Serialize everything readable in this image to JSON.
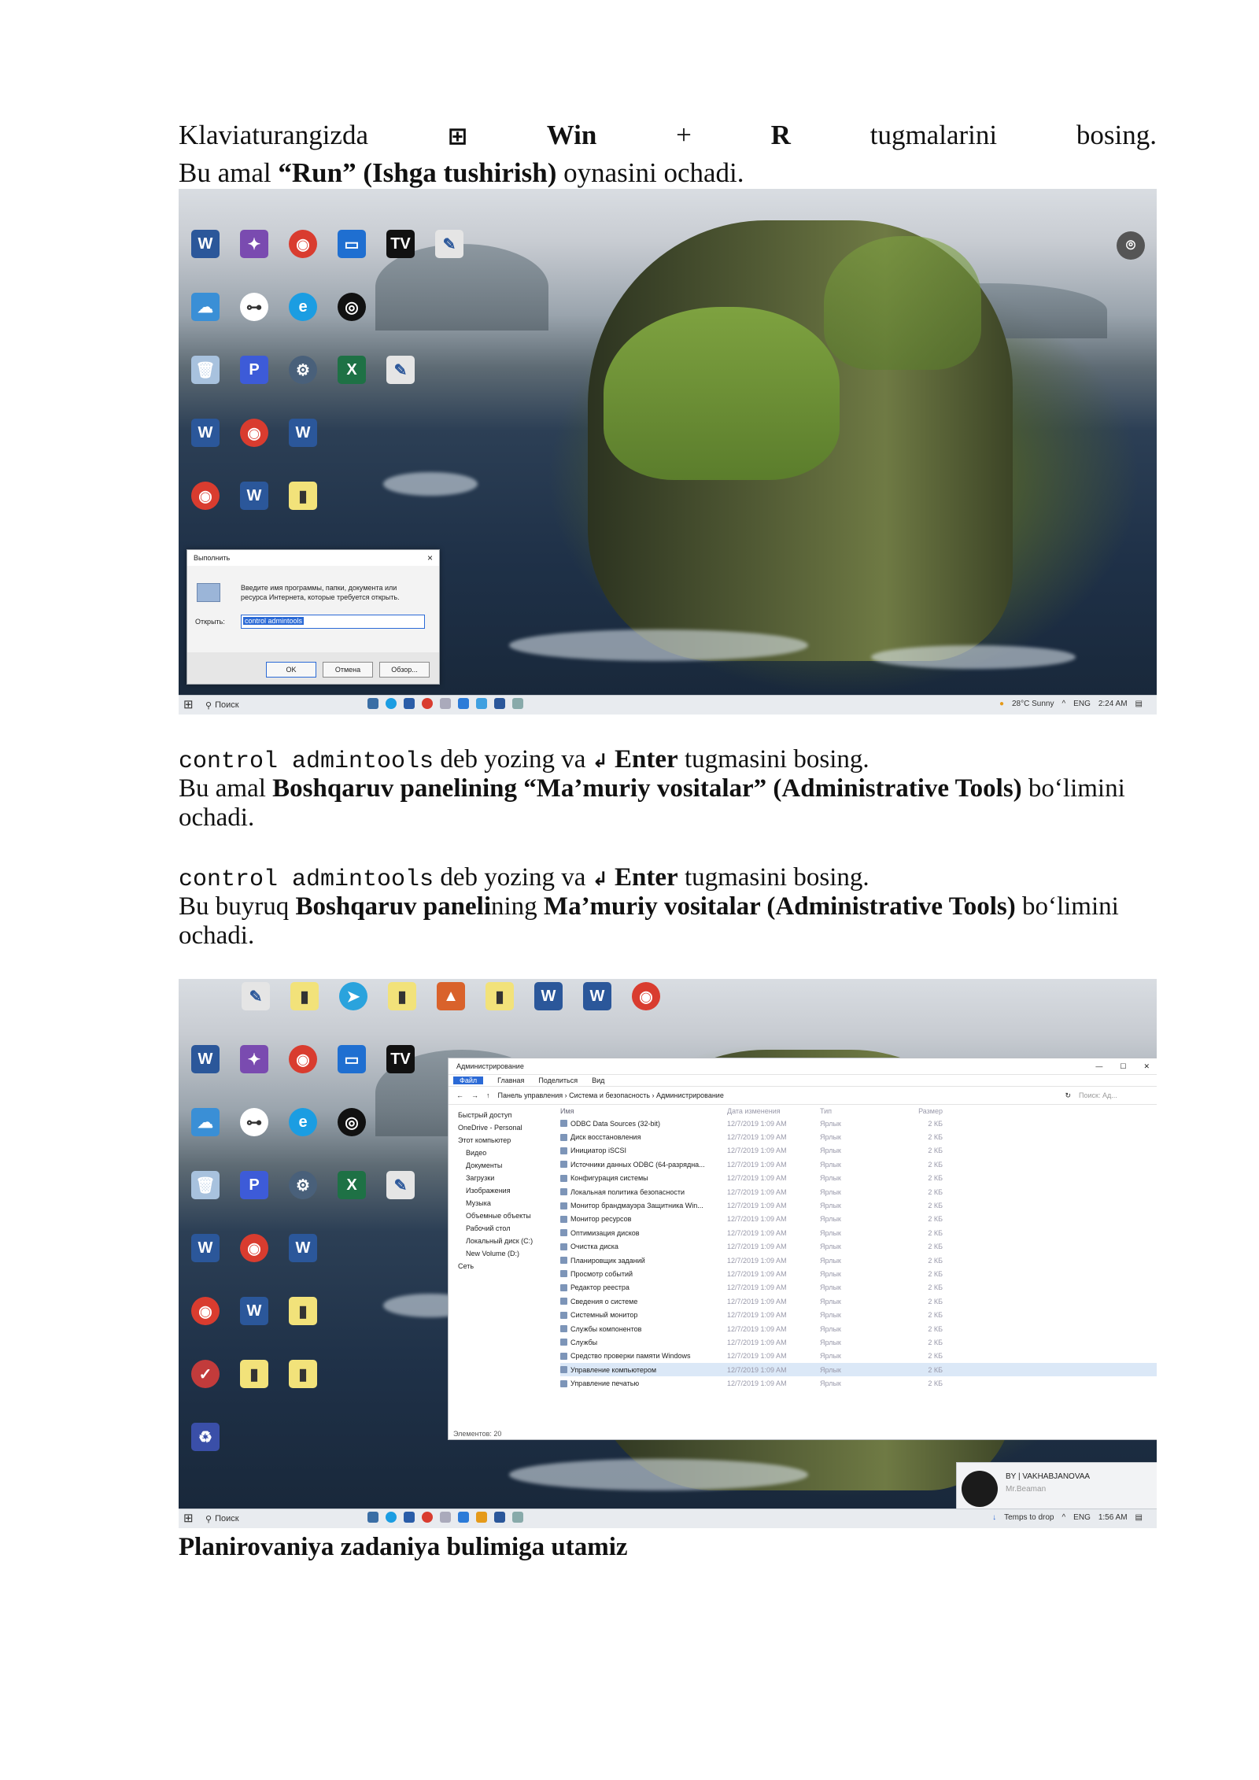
{
  "para1": {
    "line1": [
      "Klaviaturangizda",
      "⊞",
      "Win",
      "+",
      "R",
      "tugmalarini",
      "bosing."
    ],
    "line2_pre": "Bu amal ",
    "line2_bold": "“Run” (Ishga tushirish)",
    "line2_post": " oynasini ochadi."
  },
  "shot1": {
    "run_dialog": {
      "title": "Выполнить",
      "close": "×",
      "description": "Введите имя программы, папки, документа или ресурса Интернета, которые требуется открыть.",
      "open_label": "Открыть:",
      "input_value": "control admintools",
      "ok": "OK",
      "cancel": "Отмена",
      "browse": "Обзор..."
    },
    "taskbar": {
      "search": "Поиск",
      "weather": "28°C Sunny",
      "lang": "ENG",
      "time": "2:24 AM"
    }
  },
  "para2": {
    "cmd": "control admintools",
    "mid": " deb yozing va ",
    "enter_sym": "↲",
    "enter_bold": " Enter",
    "end": " tugmasini bosing.",
    "l2_pre": "Bu amal ",
    "l2_bold": "Boshqaruv panelining “Ma’muriy vositalar” (Administrative Tools)",
    "l2_post": " bo‘limini",
    "l3": "ochadi."
  },
  "para3": {
    "cmd": "control admintools",
    "mid": " deb yozing va ",
    "enter_sym": "↲",
    "enter_bold": " Enter",
    "end": " tugmasini bosing.",
    "l2_pre": "Bu buyruq ",
    "l2_bold1": "Boshqaruv paneli",
    "l2_mid": "ning ",
    "l2_bold2": "Ma’muriy vositalar (Administrative Tools)",
    "l2_post": " bo‘limini",
    "l3": "ochadi."
  },
  "shot2": {
    "explorer": {
      "title": "Администрирование",
      "ribbon": [
        "Файл",
        "Главная",
        "Поделиться",
        "Вид"
      ],
      "breadcrumb": "Панель управления › Система и безопасность › Администрирование",
      "search_placeholder": "Поиск: Ад...",
      "nav": [
        "Быстрый доступ",
        "OneDrive - Personal",
        "Этот компьютер",
        "Видео",
        "Документы",
        "Загрузки",
        "Изображения",
        "Музыка",
        "Объемные объекты",
        "Рабочий стол",
        "Локальный диск (C:)",
        "New Volume (D:)",
        "Сеть"
      ],
      "headers": [
        "Имя",
        "Дата изменения",
        "Тип",
        "Размер"
      ],
      "files": [
        "ODBC Data Sources (32-bit)",
        "Диск восстановления",
        "Инициатор iSCSI",
        "Источники данных ODBC (64-разрядна...",
        "Конфигурация системы",
        "Локальная политика безопасности",
        "Монитор брандмауэра Защитника Win...",
        "Монитор ресурсов",
        "Оптимизация дисков",
        "Очистка диска",
        "Планировщик заданий",
        "Просмотр событий",
        "Редактор реестра",
        "Сведения о системе",
        "Системный монитор",
        "Службы компонентов",
        "Службы",
        "Средство проверки памяти Windows",
        "Управление компьютером",
        "Управление печатью"
      ],
      "selected_index": 18,
      "date": "12/7/2019 1:09 AM",
      "type": "Ярлык",
      "size": "2 КБ",
      "status": "Элементов: 20"
    },
    "toast": {
      "line1": "BY | VAKHABJANOVAA",
      "line2": "Mr.Beaman"
    },
    "taskbar": {
      "search": "Поиск",
      "weather": "Temps to drop",
      "lang": "ENG",
      "time": "1:56 AM"
    }
  },
  "para4": {
    "text": "Planirovaniya zadaniya bulimiga utamiz"
  },
  "desktop_icons": [
    "Word",
    "Deezer",
    "Chrome",
    "Outlook",
    "TradingView",
    "Bin",
    "Skype",
    "Edge",
    "Vpn",
    "Excel",
    "Print",
    "Word",
    "Chrome",
    "Word",
    "Google Chrome",
    "Word",
    "File",
    "CCleaner",
    "File",
    "File",
    "Data Recovery"
  ]
}
